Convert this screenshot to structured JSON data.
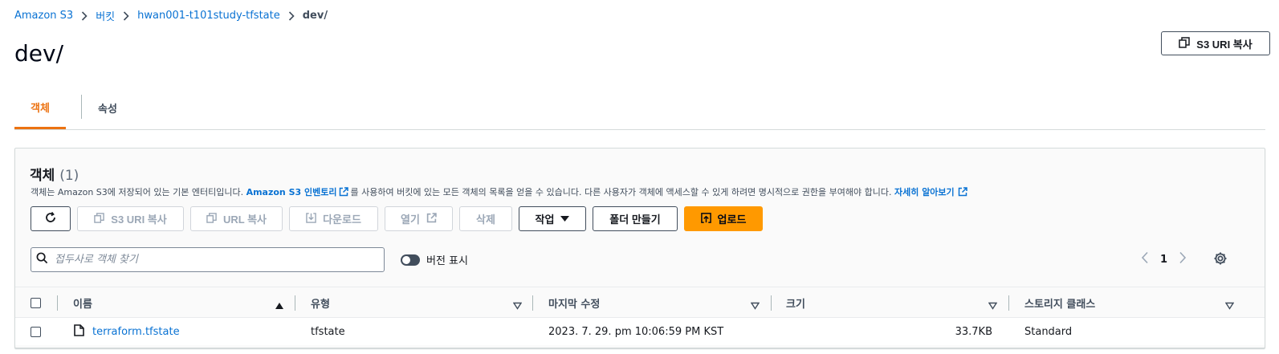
{
  "breadcrumb": {
    "items": [
      "Amazon S3",
      "버킷",
      "hwan001-t101study-tfstate"
    ],
    "current": "dev/"
  },
  "page": {
    "title": "dev/",
    "copy_uri_label": "S3 URI 복사"
  },
  "tabs": [
    {
      "label": "객체",
      "active": true
    },
    {
      "label": "속성",
      "active": false
    }
  ],
  "objects_panel": {
    "title": "객체",
    "count": "(1)",
    "description_prefix": "객체는 Amazon S3에 저장되어 있는 기본 엔터티입니다.",
    "inventory_link": "Amazon S3 인벤토리",
    "description_middle": "를 사용하여 버킷에 있는 모든 객체의 목록을 얻을 수 있습니다. 다른 사용자가 객체에 액세스할 수 있게 하려면 명시적으로 권한을 부여해야 합니다.",
    "learn_more_link": "자세히 알아보기"
  },
  "toolbar": {
    "refresh_icon": "refresh-icon",
    "copy_s3_uri": "S3 URI 복사",
    "copy_url": "URL 복사",
    "download": "다운로드",
    "open": "열기",
    "delete": "삭제",
    "actions": "작업",
    "create_folder": "폴더 만들기",
    "upload": "업로드"
  },
  "search": {
    "placeholder": "접두사로 객체 찾기"
  },
  "versions_toggle": {
    "label": "버전 표시",
    "on": false
  },
  "pagination": {
    "current_page": "1"
  },
  "table": {
    "columns": [
      "이름",
      "유형",
      "마지막 수정",
      "크기",
      "스토리지 클래스"
    ],
    "rows": [
      {
        "name": "terraform.tfstate",
        "type": "tfstate",
        "last_modified": "2023. 7. 29. pm 10:06:59 PM KST",
        "size": "33.7KB",
        "storage_class": "Standard"
      }
    ]
  },
  "colors": {
    "link": "#0972d3",
    "accent_tab": "#ec7211",
    "primary_button": "#ff9900",
    "disabled_text": "#9ba7b6"
  }
}
